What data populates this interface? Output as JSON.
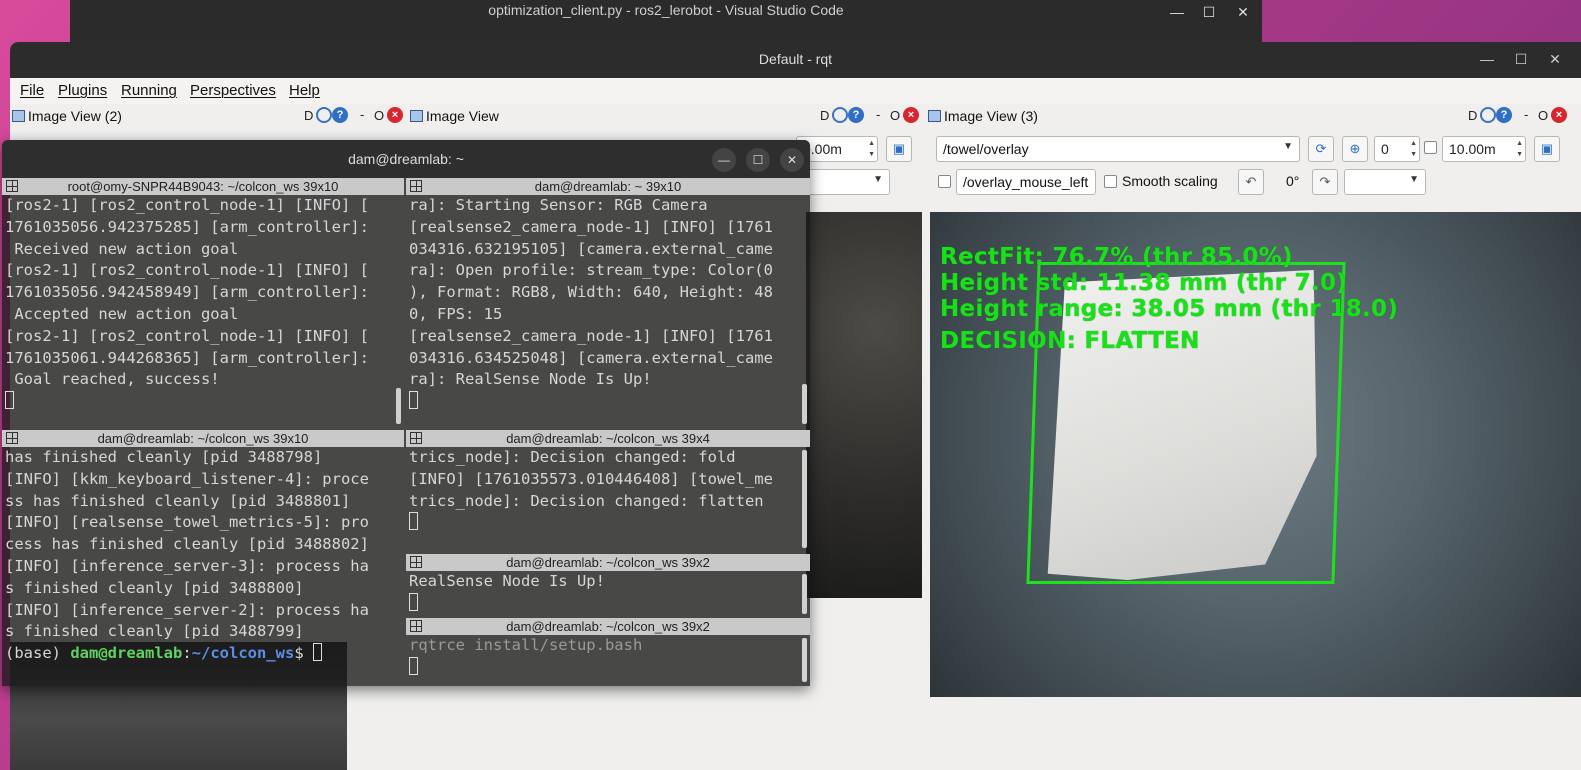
{
  "vscode": {
    "title": "optimization_client.py - ros2_lerobot - Visual Studio Code"
  },
  "rqt": {
    "title": "Default - rqt",
    "menu": [
      "File",
      "Plugins",
      "Running",
      "Perspectives",
      "Help"
    ],
    "docks": {
      "left_title": "Image View (2)",
      "mid_title": "Image View",
      "right_title": "Image View (3)",
      "ctrl_d": "D",
      "ctrl_dash": "-",
      "ctrl_o": "O"
    },
    "right_toolbar": {
      "topic": "/towel/overlay",
      "spin_value": "0",
      "max_range": "10.00m",
      "mid_max_range": "0.00m",
      "mouse_topic": "/overlay_mouse_left",
      "smooth_scaling_label": "Smooth scaling",
      "rotation": "0°"
    },
    "overlay": {
      "line1": "RectFit: 76.7% (thr 85.0%)",
      "line2": "Height std: 11.38 mm (thr 7.0)",
      "line3": "Height range: 38.05 mm (thr 18.0)",
      "line4": "DECISION: FLATTEN",
      "color": "#19e119"
    }
  },
  "terminal": {
    "title": "dam@dreamlab: ~",
    "panes": {
      "p1": {
        "header": "root@omy-SNPR44B9043: ~/colcon_ws 39x10",
        "lines": [
          "[ros2-1] [ros2_control_node-1] [INFO] [",
          "1761035056.942375285] [arm_controller]:",
          " Received new action goal",
          "[ros2-1] [ros2_control_node-1] [INFO] [",
          "1761035056.942458949] [arm_controller]:",
          " Accepted new action goal",
          "[ros2-1] [ros2_control_node-1] [INFO] [",
          "1761035061.944268365] [arm_controller]:",
          " Goal reached, success!"
        ]
      },
      "p2": {
        "header": "dam@dreamlab: ~ 39x10",
        "lines": [
          "ra]: Starting Sensor: RGB Camera",
          "[realsense2_camera_node-1] [INFO] [1761",
          "034316.632195105] [camera.external_came",
          "ra]: Open profile: stream_type: Color(0",
          "), Format: RGB8, Width: 640, Height: 48",
          "0, FPS: 15",
          "[realsense2_camera_node-1] [INFO] [1761",
          "034316.634525048] [camera.external_came",
          "ra]: RealSense Node Is Up!"
        ]
      },
      "p3": {
        "header": "dam@dreamlab: ~/colcon_ws 39x10",
        "lines": [
          "has finished cleanly [pid 3488798]",
          "[INFO] [kkm_keyboard_listener-4]: proce",
          "ss has finished cleanly [pid 3488801]",
          "[INFO] [realsense_towel_metrics-5]: pro",
          "cess has finished cleanly [pid 3488802]",
          "[INFO] [inference_server-3]: process ha",
          "s finished cleanly [pid 3488800]",
          "[INFO] [inference_server-2]: process ha",
          "s finished cleanly [pid 3488799]"
        ],
        "prompt_base": "(base) ",
        "prompt_user": "dam@dreamlab",
        "prompt_colon": ":",
        "prompt_path": "~/colcon_ws",
        "prompt_dollar": "$ "
      },
      "p4": {
        "header": "dam@dreamlab: ~/colcon_ws 39x4",
        "lines": [
          "trics_node]: Decision changed: fold",
          "[INFO] [1761035573.010446408] [towel_me",
          "trics_node]: Decision changed: flatten"
        ]
      },
      "p5": {
        "header": "dam@dreamlab: ~/colcon_ws 39x2",
        "lines": [
          "RealSense Node Is Up!"
        ]
      },
      "p6": {
        "header": "dam@dreamlab: ~/colcon_ws 39x2",
        "lines": [
          "rqtrce install/setup.bash"
        ]
      }
    }
  }
}
